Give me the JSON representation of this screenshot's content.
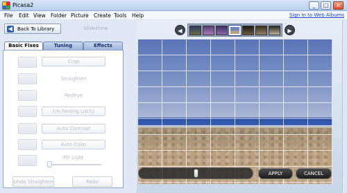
{
  "window": {
    "title": "Picasa2",
    "minimize": "_",
    "maximize": "□",
    "close": "×"
  },
  "menu": {
    "items": [
      "File",
      "Edit",
      "View",
      "Folder",
      "Picture",
      "Create",
      "Tools",
      "Help"
    ],
    "signin": "Sign In to Web Albums"
  },
  "toolbar": {
    "back_label": "Back To Library",
    "back_arrow": "◀",
    "slideshow_label": "Slideshow"
  },
  "tabs": {
    "basic": "Basic Fixes",
    "tuning": "Tuning",
    "effects": "Effects"
  },
  "fixes": {
    "crop": "Crop",
    "straighten": "Straighten",
    "redeye": "Redeye",
    "lucky": "I'm Feeling Lucky",
    "auto_contrast": "Auto Contrast",
    "auto_color": "Auto Color",
    "fill_light": "Fill Light"
  },
  "bottom": {
    "undo": "Undo Straighten",
    "redo": "Redo"
  },
  "filmstrip": {
    "prev": "◀",
    "next": "▶"
  },
  "straighten_panel": {
    "apply": "APPLY",
    "cancel": "CANCEL"
  }
}
